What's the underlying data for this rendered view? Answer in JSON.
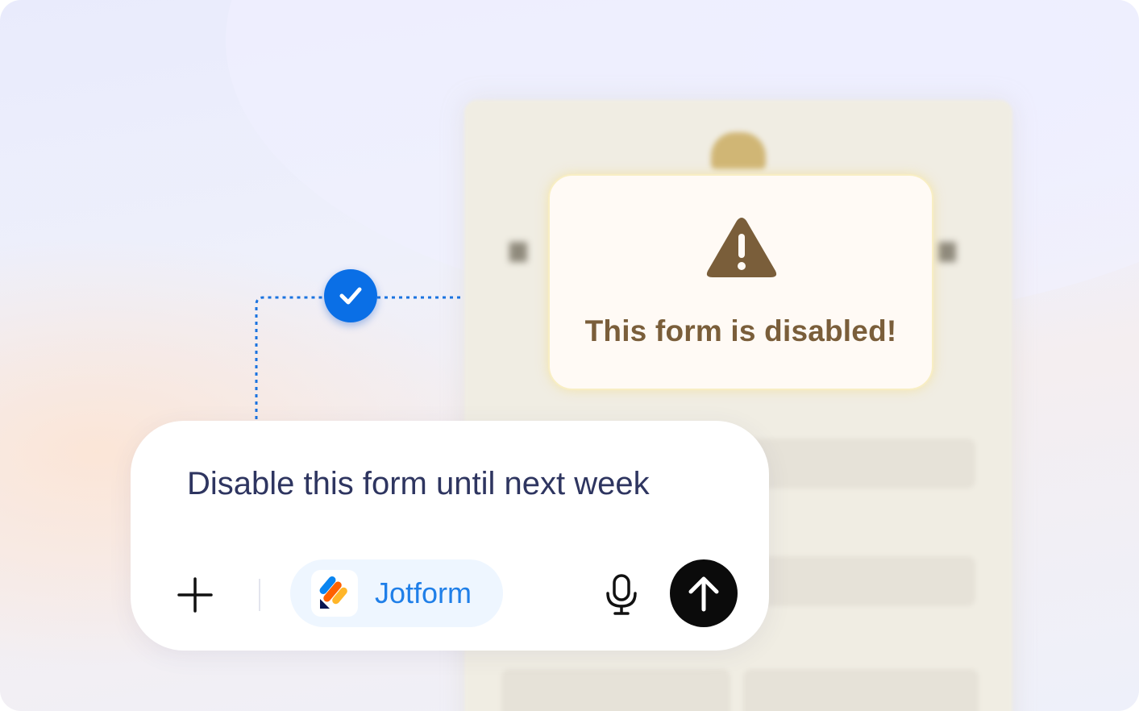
{
  "warning": {
    "message": "This form is disabled!",
    "icon": "warning-triangle-icon",
    "text_color": "#7a5e3a"
  },
  "connector": {
    "status_icon": "check-icon",
    "badge_color": "#0a6fe6"
  },
  "composer": {
    "prompt": "Disable this form until next week",
    "add_icon": "plus-icon",
    "integration": {
      "label": "Jotform",
      "icon": "jotform-logo-icon",
      "color": "#1f7fe8"
    },
    "mic_icon": "microphone-icon",
    "send_icon": "arrow-up-icon"
  }
}
